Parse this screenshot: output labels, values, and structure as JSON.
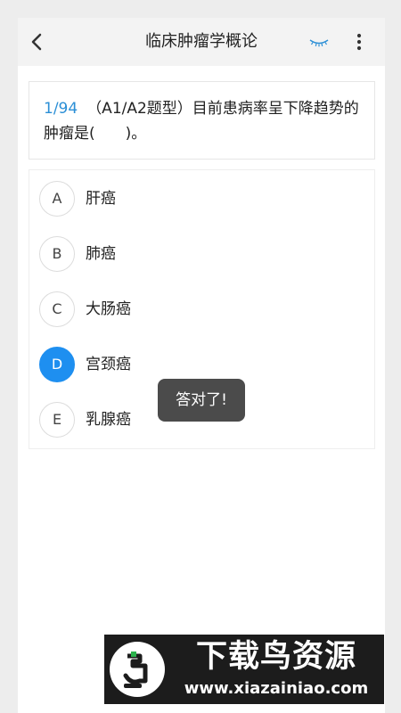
{
  "header": {
    "title": "临床肿瘤学概论",
    "back_icon": "chevron-left-icon",
    "eye_icon": "eye-closed-icon",
    "more_icon": "more-vertical-icon"
  },
  "question": {
    "number": "1/94",
    "text": "（A1/A2题型）目前患病率呈下降趋势的肿瘤是(　　)。"
  },
  "options": [
    {
      "letter": "A",
      "text": "肝癌",
      "selected": false
    },
    {
      "letter": "B",
      "text": "肺癌",
      "selected": false
    },
    {
      "letter": "C",
      "text": "大肠癌",
      "selected": false
    },
    {
      "letter": "D",
      "text": "宫颈癌",
      "selected": true
    },
    {
      "letter": "E",
      "text": "乳腺癌",
      "selected": false
    }
  ],
  "toast": {
    "text": "答对了!"
  },
  "watermark": {
    "title": "下载鸟资源",
    "url": "www.xiazainiao.com"
  },
  "colors": {
    "accent": "#1e8ff0",
    "question_number": "#2b8fd6",
    "toast_bg": "#4b4b4b"
  }
}
